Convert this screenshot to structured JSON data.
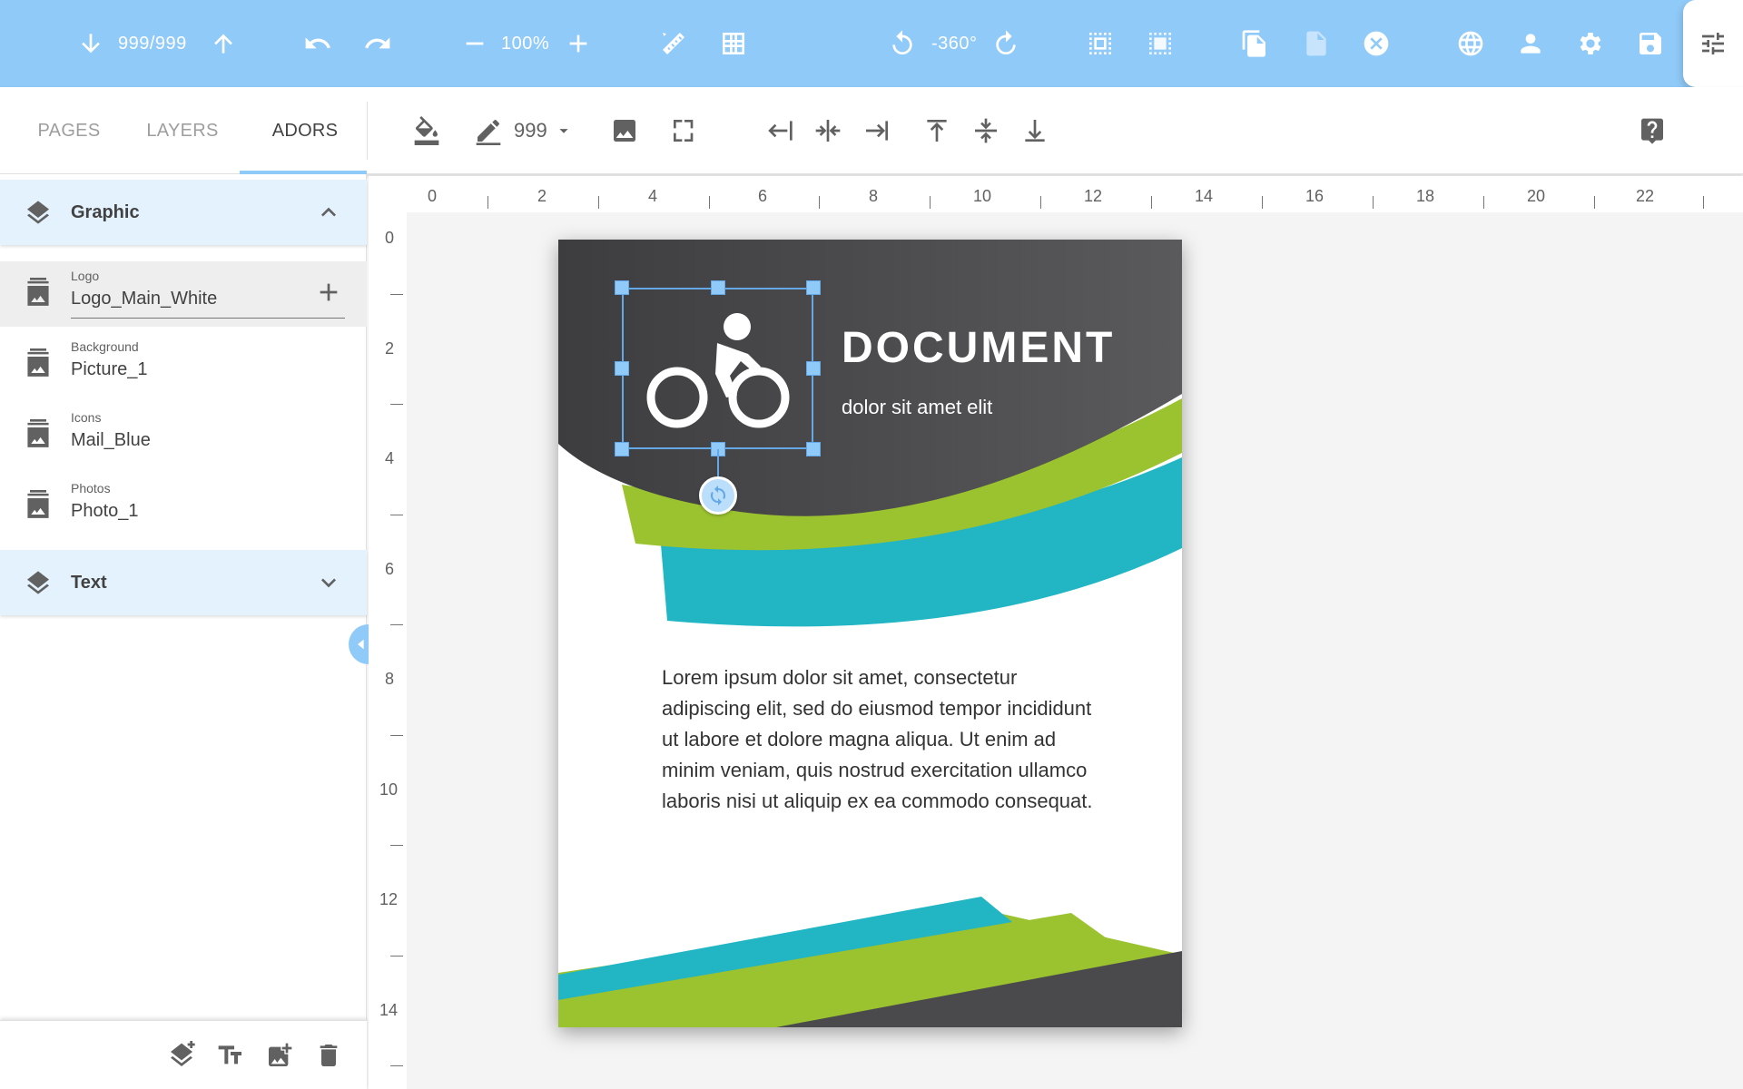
{
  "topbar": {
    "page_counter": "999/999",
    "zoom": "100%",
    "rotation": "-360°",
    "icons": [
      "arrow-down-icon",
      "arrow-up-icon",
      "undo-icon",
      "redo-icon",
      "zoom-out-icon",
      "zoom-in-icon",
      "ruler-icon",
      "grid-icon",
      "rotate-left-icon",
      "rotate-right-icon",
      "select-all-icon",
      "deselect-icon",
      "copy-page-icon",
      "page-icon",
      "close-circle-icon",
      "globe-icon",
      "user-icon",
      "settings-icon",
      "save-icon",
      "tune-icon"
    ]
  },
  "tabs": [
    {
      "label": "PAGES",
      "active": false
    },
    {
      "label": "LAYERS",
      "active": false
    },
    {
      "label": "ADORS",
      "active": true
    }
  ],
  "toolbar2": {
    "stroke_width": "999",
    "icons": [
      "fill-color-icon",
      "pen-icon",
      "dropdown-icon",
      "image-icon",
      "fullscreen-icon",
      "align-left-icon",
      "align-center-horizontal-icon",
      "align-right-icon",
      "align-top-icon",
      "align-middle-vertical-icon",
      "align-bottom-icon",
      "help-icon"
    ]
  },
  "panel": {
    "groups": [
      {
        "label": "Graphic",
        "expanded": true,
        "items": [
          {
            "caption": "Logo",
            "value": "Logo_Main_White",
            "selected": true
          },
          {
            "caption": "Background",
            "value": "Picture_1",
            "selected": false
          },
          {
            "caption": "Icons",
            "value": "Mail_Blue",
            "selected": false
          },
          {
            "caption": "Photos",
            "value": "Photo_1",
            "selected": false
          }
        ]
      },
      {
        "label": "Text",
        "expanded": false,
        "items": []
      }
    ],
    "bottom_icons": [
      "add-layer-icon",
      "add-text-icon",
      "add-image-icon",
      "delete-icon"
    ]
  },
  "ruler": {
    "top_labels": [
      "0",
      "2",
      "4",
      "6",
      "8",
      "10",
      "12",
      "14",
      "16",
      "18",
      "20",
      "22"
    ],
    "left_labels": [
      "0",
      "2",
      "4",
      "6",
      "8",
      "10",
      "12",
      "14"
    ]
  },
  "document": {
    "title": "DOCUMENT",
    "subtitle": "dolor sit amet elit",
    "body": "Lorem ipsum dolor sit amet, consectetur adipiscing elit, sed do eiusmod tempor incididunt ut labore et dolore magna aliqua. Ut enim ad minim veniam, quis nostrud exercitation ullamco laboris nisi ut aliquip ex ea commodo consequat.",
    "colors": {
      "dark": "#4a4a4c",
      "green": "#9bc22f",
      "teal": "#22b5c4"
    },
    "logo_icon": "bicycle-icon"
  },
  "colors": {
    "accent": "#90caf9",
    "panel_highlight": "#e3f2fd"
  }
}
